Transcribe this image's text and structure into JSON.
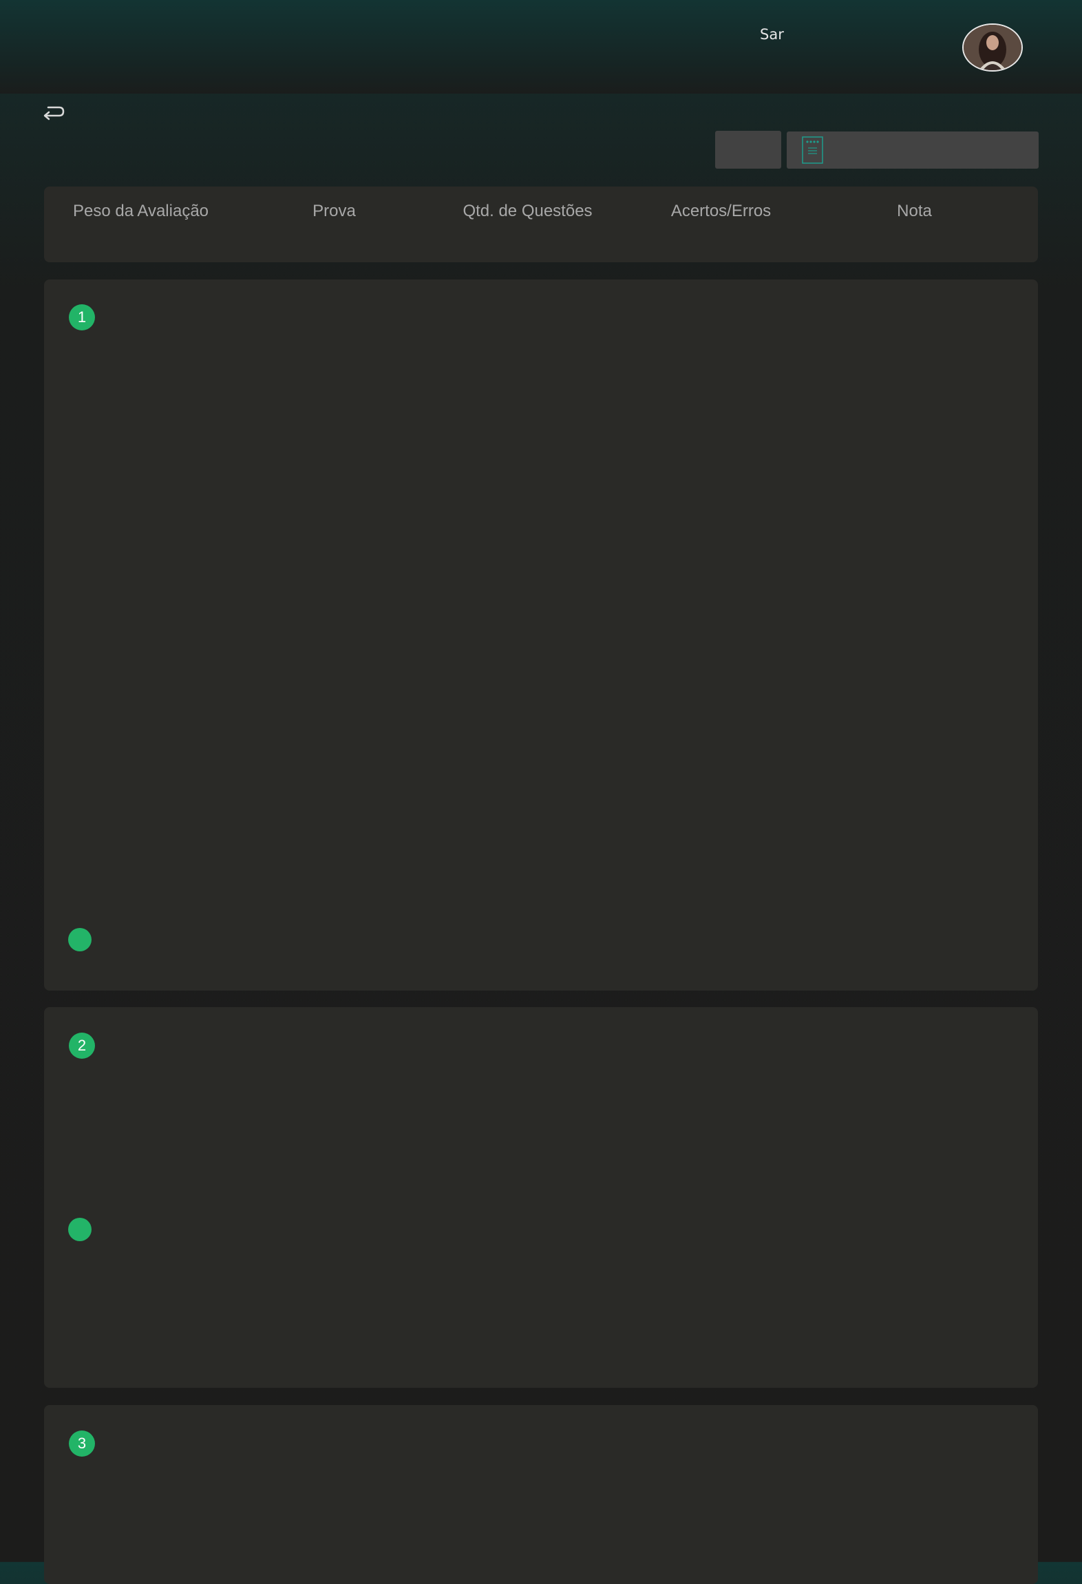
{
  "header": {
    "username": "Sar"
  },
  "summary": {
    "columns": [
      "Peso da Avaliação",
      "Prova",
      "Qtd. de Questões",
      "Acertos/Erros",
      "Nota"
    ]
  },
  "questions": [
    {
      "number": "1"
    },
    {
      "number": "2"
    },
    {
      "number": "3"
    }
  ],
  "colors": {
    "accent_green": "#22b467",
    "card_bg": "#2a2a27",
    "page_bg": "#1c1c1b",
    "header_teal": "#133433"
  },
  "icons": {
    "back": "return-arrow-icon",
    "document": "document-icon",
    "avatar": "user-avatar"
  }
}
